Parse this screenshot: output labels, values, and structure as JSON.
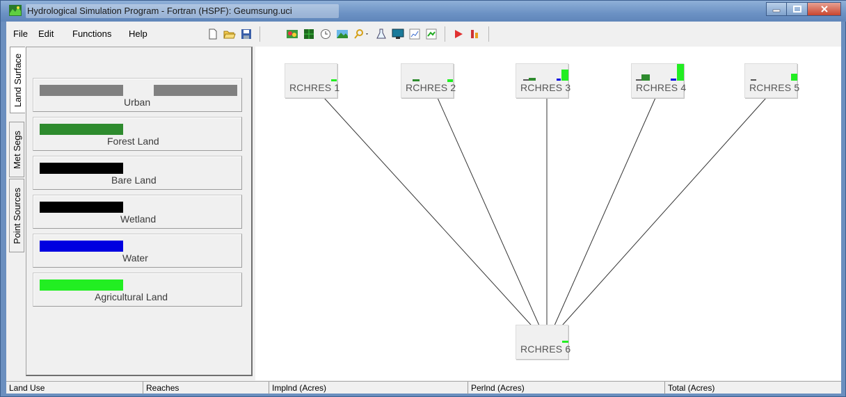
{
  "window": {
    "title": "Hydrological Simulation Program - Fortran (HSPF): Geumsung.uci",
    "controls": [
      "minimize",
      "maximize",
      "close"
    ]
  },
  "menu": {
    "file": "File",
    "edit": "Edit",
    "functions": "Functions",
    "help": "Help"
  },
  "toolbar": {
    "file_icons": [
      "new-icon",
      "open-folder-icon",
      "save-icon"
    ],
    "tool_icons": [
      "map-icon",
      "grid-icon",
      "clock-icon",
      "landscape-icon",
      "search-dropdown-icon",
      "flask-icon",
      "monitor-icon",
      "chart-icon",
      "graph-icon",
      "run-icon",
      "analysis-icon"
    ]
  },
  "side_tabs": {
    "land_surface": "Land Surface",
    "met_segs": "Met Segs",
    "point_sources": "Point Sources"
  },
  "land_uses": [
    {
      "label": "Urban",
      "color": "#808080",
      "bars": 2
    },
    {
      "label": "Forest Land",
      "color": "#2e8b2e",
      "bars": 1
    },
    {
      "label": "Bare Land",
      "color": "#000000",
      "bars": 1
    },
    {
      "label": "Wetland",
      "color": "#000000",
      "bars": 1
    },
    {
      "label": "Water",
      "color": "#0000e0",
      "bars": 1
    },
    {
      "label": "Agricultural Land",
      "color": "#22ee22",
      "bars": 1
    }
  ],
  "reaches": [
    {
      "label": "RCHRES 1"
    },
    {
      "label": "RCHRES 2"
    },
    {
      "label": "RCHRES 3"
    },
    {
      "label": "RCHRES 4"
    },
    {
      "label": "RCHRES 5"
    },
    {
      "label": "RCHRES 6"
    }
  ],
  "status": {
    "land_use": "Land Use",
    "reaches": "Reaches",
    "implnd": "Implnd (Acres)",
    "perlnd": "Perlnd (Acres)",
    "total": "Total (Acres)"
  }
}
